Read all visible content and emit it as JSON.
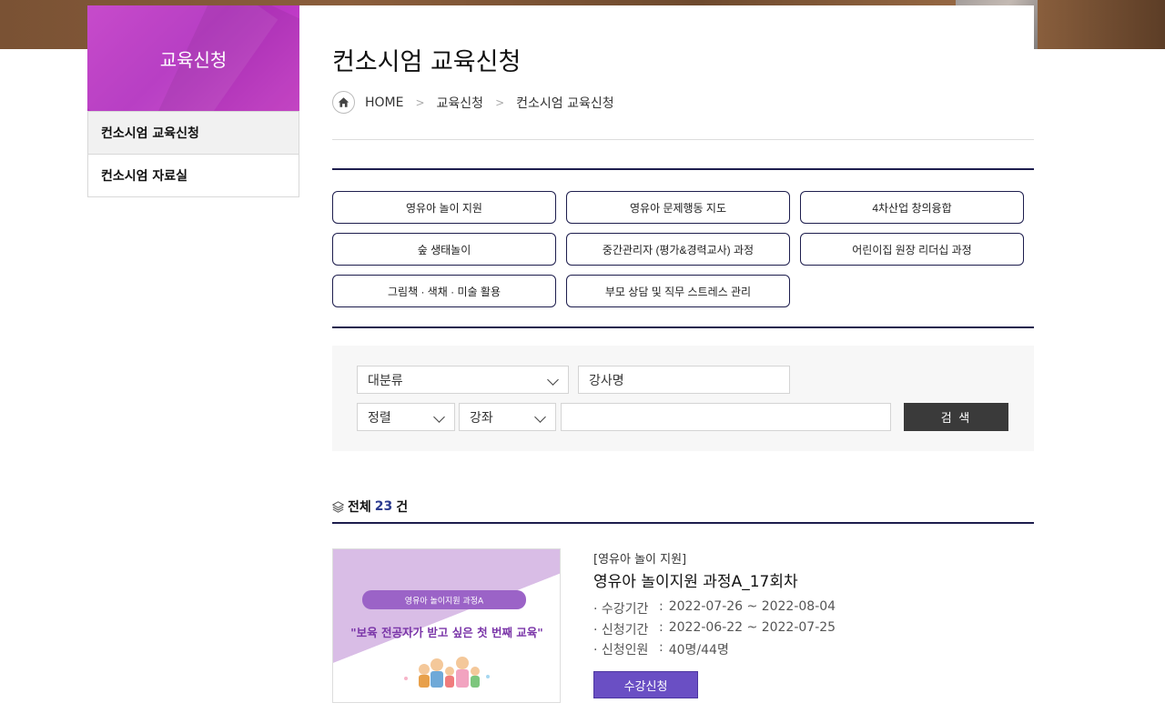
{
  "sidebar": {
    "header": "교육신청",
    "items": [
      {
        "label": "컨소시엄 교육신청",
        "active": true
      },
      {
        "label": "컨소시엄 자료실",
        "active": false
      }
    ]
  },
  "page": {
    "title": "컨소시엄 교육신청",
    "breadcrumb": [
      "HOME",
      "교육신청",
      "컨소시엄 교육신청"
    ]
  },
  "categories": [
    "영유아 놀이 지원",
    "영유아 문제행동 지도",
    "4차산업 창의융합",
    "숲 생태놀이",
    "중간관리자 (평가&경력교사) 과정",
    "어린이집 원장 리더십 과정",
    "그림책 · 색채 · 미술 활용",
    "부모 상담 및 직무 스트레스 관리"
  ],
  "search": {
    "category_select": "대분류",
    "instructor_field": "강사명",
    "sort_select": "정렬",
    "course_select": "강좌",
    "keyword_value": "",
    "button_label": "검 색"
  },
  "results": {
    "label_prefix": "전체",
    "count": "23",
    "label_suffix": "건"
  },
  "course": {
    "category": "[영유아 놀이 지원]",
    "title": "영유아 놀이지원 과정A_17회차",
    "thumb_badge": "영유아 놀이지원 과정A",
    "thumb_slogan": "\"보육 전공자가 받고 싶은 첫 번째 교육\"",
    "info": [
      {
        "label": "· 수강기간",
        "value": "2022-07-26 ~ 2022-08-04"
      },
      {
        "label": "· 신청기간",
        "value": "2022-06-22 ~ 2022-07-25"
      },
      {
        "label": "· 신청인원",
        "value": "40명/44명"
      }
    ],
    "apply_label": "수강신청"
  },
  "colors": {
    "sidebar_header": "#c23cc7",
    "navy_rule": "#1d1d4d",
    "apply_button": "#6a4fc4",
    "search_button": "#3a3a3a"
  }
}
